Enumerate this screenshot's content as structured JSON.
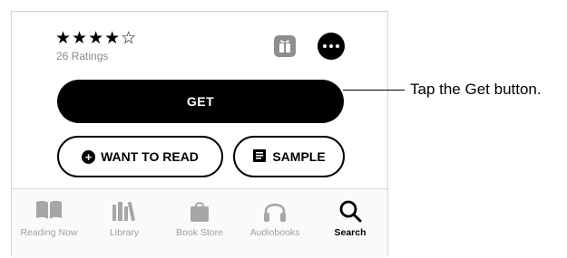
{
  "rating": {
    "stars_text": "★★★★☆",
    "stars": 4,
    "max_stars": 5,
    "count_label": "26 Ratings"
  },
  "actions": {
    "get_label": "GET",
    "want_label": "WANT TO READ",
    "sample_label": "SAMPLE"
  },
  "tabs": [
    {
      "label": "Reading Now",
      "icon": "book-open-icon",
      "active": false
    },
    {
      "label": "Library",
      "icon": "library-icon",
      "active": false
    },
    {
      "label": "Book Store",
      "icon": "shopping-bag-icon",
      "active": false
    },
    {
      "label": "Audiobooks",
      "icon": "headphones-icon",
      "active": false
    },
    {
      "label": "Search",
      "icon": "search-icon",
      "active": true
    }
  ],
  "callout": {
    "text": "Tap the Get button."
  },
  "colors": {
    "inactive_tab": "#a0a0a0",
    "active_tab": "#000000",
    "button": "#000000"
  }
}
